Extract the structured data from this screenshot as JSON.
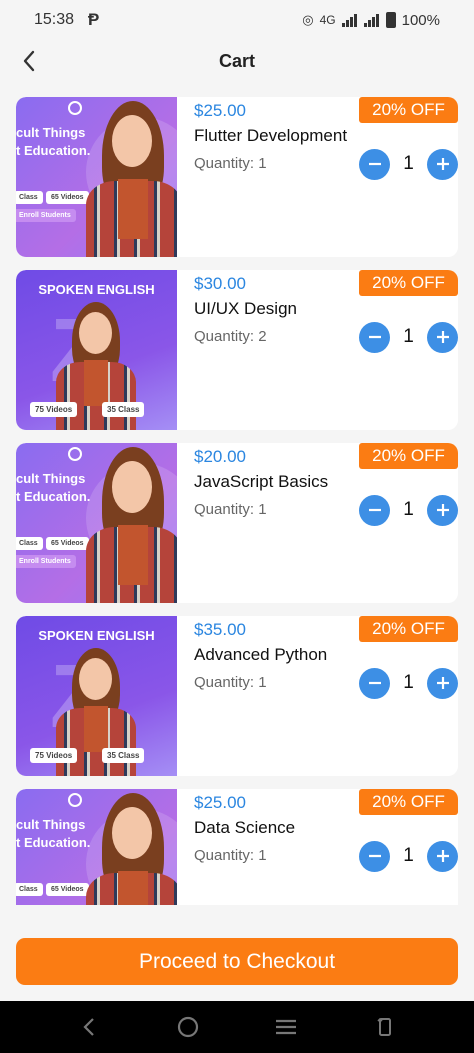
{
  "status": {
    "time": "15:38",
    "carrier_icon": "p-icon",
    "network": "4G",
    "battery": "100%"
  },
  "header": {
    "title": "Cart",
    "back_icon": "chevron-left-icon"
  },
  "thumbnails": {
    "a": {
      "line1": "cult Things",
      "line2": "t Education.",
      "pill1": "Class",
      "pill2": "65 Videos",
      "pill3": "Enroll Students"
    },
    "b": {
      "title": "SPOKEN ENGLISH",
      "pill1": "75 Videos",
      "pill2": "35 Class"
    }
  },
  "items": [
    {
      "price": "$25.00",
      "name": "Flutter Development",
      "quantity_text": "Quantity: 1",
      "discount": "20% OFF",
      "stepper_value": "1",
      "thumb": "a"
    },
    {
      "price": "$30.00",
      "name": "UI/UX Design",
      "quantity_text": "Quantity: 2",
      "discount": "20% OFF",
      "stepper_value": "1",
      "thumb": "b"
    },
    {
      "price": "$20.00",
      "name": "JavaScript Basics",
      "quantity_text": "Quantity: 1",
      "discount": "20% OFF",
      "stepper_value": "1",
      "thumb": "a"
    },
    {
      "price": "$35.00",
      "name": "Advanced Python",
      "quantity_text": "Quantity: 1",
      "discount": "20% OFF",
      "stepper_value": "1",
      "thumb": "b"
    },
    {
      "price": "$25.00",
      "name": "Data Science",
      "quantity_text": "Quantity: 1",
      "discount": "20% OFF",
      "stepper_value": "1",
      "thumb": "a"
    }
  ],
  "checkout": {
    "label": "Proceed to Checkout"
  },
  "colors": {
    "accent_orange": "#fb7c13",
    "price_blue": "#2b86e0",
    "stepper_blue": "#3d8fe5"
  }
}
